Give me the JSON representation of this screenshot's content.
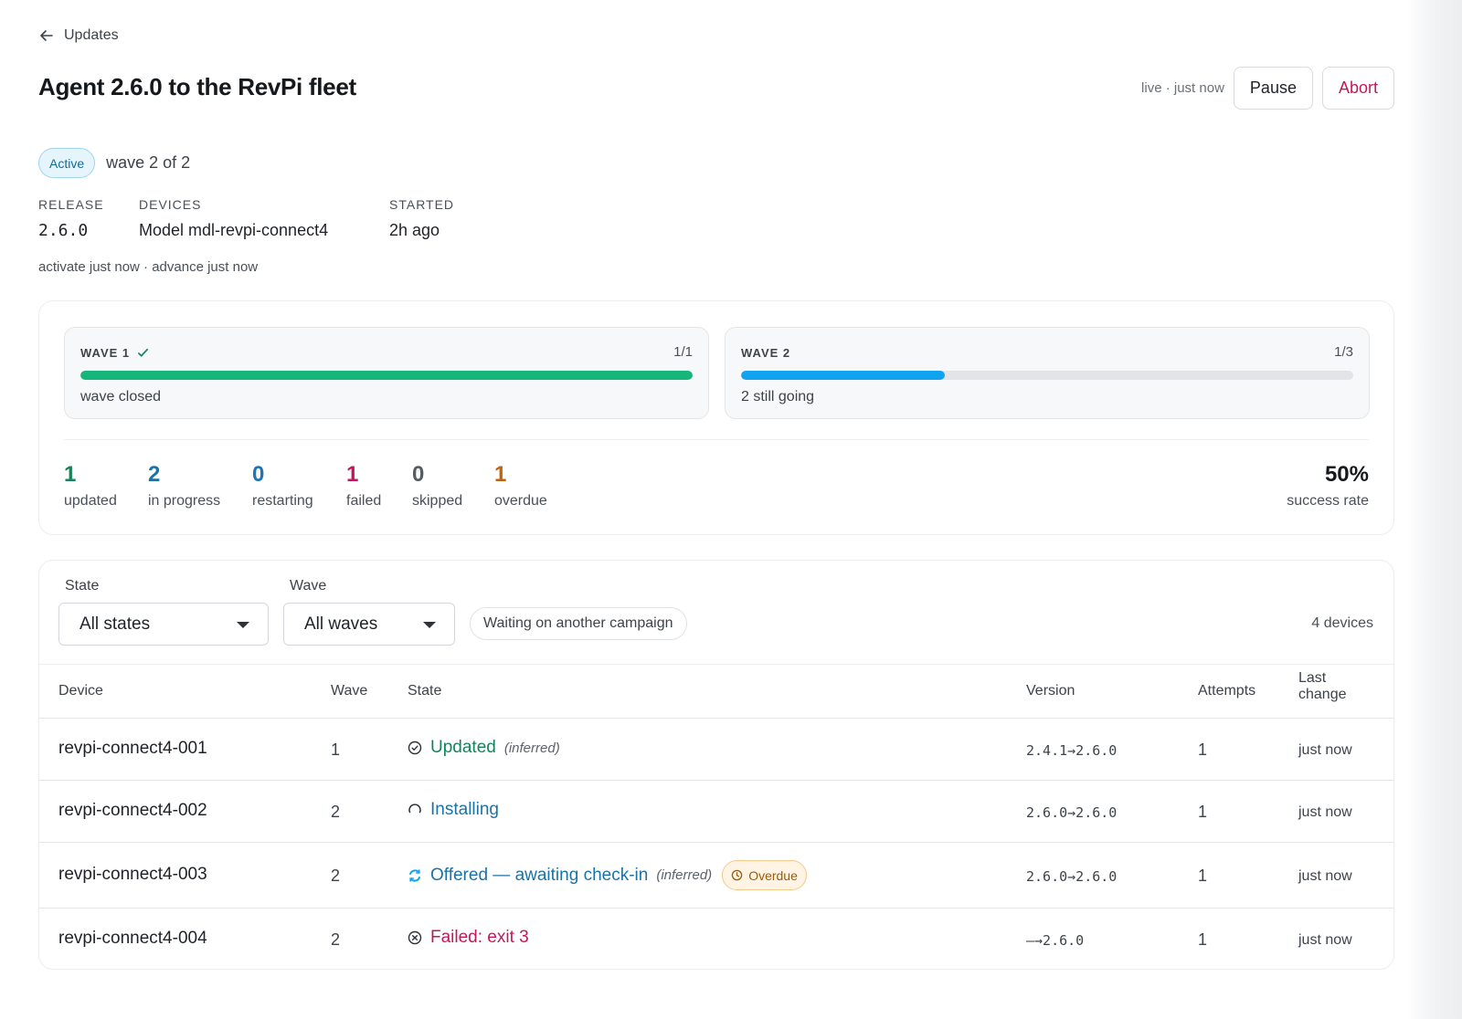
{
  "nav": {
    "back_label": "Updates"
  },
  "header": {
    "title": "Agent 2.6.0 to the RevPi fleet",
    "live_text": "live · just now",
    "pause_label": "Pause",
    "abort_label": "Abort"
  },
  "status": {
    "badge": "Active",
    "wave_text": "wave 2 of 2"
  },
  "meta": {
    "release_label": "RELEASE",
    "release_value": "2.6.0",
    "devices_label": "DEVICES",
    "devices_value": "Model mdl-revpi-connect4",
    "started_label": "STARTED",
    "started_value": "2h ago"
  },
  "activity": "activate just now · advance just now",
  "waves": [
    {
      "label": "WAVE 1",
      "count": "1/1",
      "progress": 1.0,
      "note": "wave closed",
      "color": "#16b67a",
      "done": true
    },
    {
      "label": "WAVE 2",
      "count": "1/3",
      "progress": 0.333,
      "note": "2 still going",
      "color": "#12a3f0",
      "done": false
    }
  ],
  "stats": [
    {
      "value": "1",
      "label": "updated",
      "color": "#16835a"
    },
    {
      "value": "2",
      "label": "in progress",
      "color": "#1b72a8"
    },
    {
      "value": "0",
      "label": "restarting",
      "color": "#1f74b3"
    },
    {
      "value": "1",
      "label": "failed",
      "color": "#c2185b"
    },
    {
      "value": "0",
      "label": "skipped",
      "color": "#555b62"
    },
    {
      "value": "1",
      "label": "overdue",
      "color": "#c2630c"
    }
  ],
  "success": {
    "value": "50%",
    "label": "success rate"
  },
  "filters": {
    "state_label": "State",
    "state_value": "All states",
    "wave_label": "Wave",
    "wave_value": "All waves",
    "chip_label": "Waiting on another campaign",
    "device_count": "4 devices"
  },
  "table": {
    "headers": {
      "device": "Device",
      "wave": "Wave",
      "state": "State",
      "version": "Version",
      "attempts": "Attempts",
      "last_change_1": "Last",
      "last_change_2": "change"
    },
    "rows": [
      {
        "device": "revpi-connect4-001",
        "wave": "1",
        "state": "Updated",
        "state_kind": "updated",
        "state_color": "#16835a",
        "inferred": "(inferred)",
        "badge": "",
        "version": "2.4.1→2.6.0",
        "attempts": "1",
        "last_change": "just now"
      },
      {
        "device": "revpi-connect4-002",
        "wave": "2",
        "state": "Installing",
        "state_kind": "installing",
        "state_color": "#1b72a8",
        "inferred": "",
        "badge": "",
        "version": "2.6.0→2.6.0",
        "attempts": "1",
        "last_change": "just now"
      },
      {
        "device": "revpi-connect4-003",
        "wave": "2",
        "state": "Offered — awaiting check-in",
        "state_kind": "offered",
        "state_color": "#1b72a8",
        "inferred": "(inferred)",
        "badge": "Overdue",
        "version": "2.6.0→2.6.0",
        "attempts": "1",
        "last_change": "just now"
      },
      {
        "device": "revpi-connect4-004",
        "wave": "2",
        "state": "Failed: exit 3",
        "state_kind": "failed",
        "state_color": "#c2185b",
        "inferred": "",
        "badge": "",
        "version": "—→2.6.0",
        "attempts": "1",
        "last_change": "just now"
      }
    ]
  }
}
